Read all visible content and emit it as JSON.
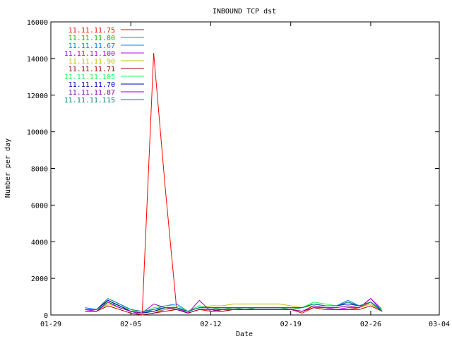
{
  "chart_data": {
    "type": "line",
    "title": "INBOUND TCP dst",
    "xlabel": "Date",
    "ylabel": "Number per day",
    "x_ticks": [
      "01-29",
      "02-05",
      "02-12",
      "02-19",
      "02-26",
      "03-04"
    ],
    "y_ticks": [
      "0",
      "2000",
      "4000",
      "6000",
      "8000",
      "10000",
      "12000",
      "14000",
      "16000"
    ],
    "xlim": [
      "01-29",
      "03-04"
    ],
    "ylim": [
      0,
      16000
    ],
    "legend_position": "top-left",
    "x": [
      "02-01",
      "02-02",
      "02-03",
      "02-04",
      "02-05",
      "02-06",
      "02-07",
      "02-08",
      "02-09",
      "02-10",
      "02-11",
      "02-12",
      "02-13",
      "02-14",
      "02-15",
      "02-16",
      "02-17",
      "02-18",
      "02-19",
      "02-20",
      "02-21",
      "02-22",
      "02-23",
      "02-24",
      "02-25",
      "02-26",
      "02-27"
    ],
    "series": [
      {
        "name": "11.11.11.75",
        "color": "#ff0000",
        "values": [
          300,
          300,
          800,
          500,
          200,
          100,
          14300,
          7000,
          400,
          100,
          300,
          200,
          200,
          300,
          300,
          300,
          300,
          300,
          300,
          100,
          400,
          400,
          300,
          300,
          400,
          700,
          200
        ]
      },
      {
        "name": "11.11.11.80",
        "color": "#00c000",
        "values": [
          300,
          200,
          800,
          500,
          200,
          100,
          200,
          400,
          300,
          200,
          400,
          400,
          300,
          400,
          300,
          400,
          400,
          400,
          300,
          400,
          600,
          500,
          500,
          700,
          500,
          700,
          300
        ]
      },
      {
        "name": "11.11.11.67",
        "color": "#0080ff",
        "values": [
          400,
          300,
          900,
          600,
          300,
          100,
          300,
          500,
          600,
          200,
          500,
          400,
          400,
          400,
          400,
          400,
          400,
          400,
          400,
          400,
          600,
          500,
          500,
          800,
          500,
          700,
          200
        ]
      },
      {
        "name": "11.11.11.100",
        "color": "#c000ff",
        "values": [
          300,
          200,
          700,
          400,
          200,
          0,
          100,
          300,
          400,
          100,
          300,
          300,
          300,
          300,
          300,
          300,
          300,
          300,
          300,
          200,
          500,
          400,
          300,
          400,
          400,
          900,
          300
        ]
      },
      {
        "name": "11.11.11.90",
        "color": "#c0c000",
        "values": [
          200,
          200,
          600,
          400,
          200,
          100,
          200,
          300,
          400,
          200,
          400,
          500,
          500,
          600,
          600,
          600,
          600,
          600,
          500,
          400,
          500,
          400,
          400,
          500,
          400,
          600,
          200
        ]
      },
      {
        "name": "11.11.11.71",
        "color": "#a00000",
        "values": [
          200,
          200,
          500,
          300,
          100,
          0,
          100,
          200,
          300,
          100,
          300,
          300,
          200,
          300,
          300,
          300,
          300,
          300,
          300,
          200,
          400,
          300,
          300,
          300,
          300,
          500,
          200
        ]
      },
      {
        "name": "11.11.11.105",
        "color": "#20ff60",
        "values": [
          300,
          300,
          700,
          500,
          300,
          100,
          400,
          500,
          500,
          200,
          500,
          400,
          400,
          400,
          400,
          400,
          400,
          400,
          400,
          400,
          700,
          600,
          500,
          700,
          500,
          700,
          300
        ]
      },
      {
        "name": "11.11.11.70",
        "color": "#0000c0",
        "values": [
          300,
          300,
          800,
          500,
          200,
          100,
          200,
          400,
          400,
          200,
          400,
          400,
          400,
          400,
          400,
          400,
          400,
          400,
          400,
          400,
          600,
          500,
          500,
          600,
          500,
          700,
          200
        ]
      },
      {
        "name": "11.11.11.87",
        "color": "#9000b0",
        "values": [
          200,
          200,
          700,
          400,
          200,
          100,
          600,
          400,
          300,
          100,
          800,
          200,
          300,
          300,
          300,
          300,
          300,
          300,
          300,
          200,
          500,
          400,
          400,
          500,
          400,
          900,
          200
        ]
      },
      {
        "name": "11.11.11.115",
        "color": "#008080",
        "values": [
          300,
          300,
          900,
          600,
          300,
          200,
          300,
          400,
          400,
          200,
          400,
          400,
          400,
          400,
          400,
          400,
          400,
          400,
          400,
          400,
          600,
          500,
          500,
          700,
          500,
          700,
          200
        ]
      }
    ]
  }
}
